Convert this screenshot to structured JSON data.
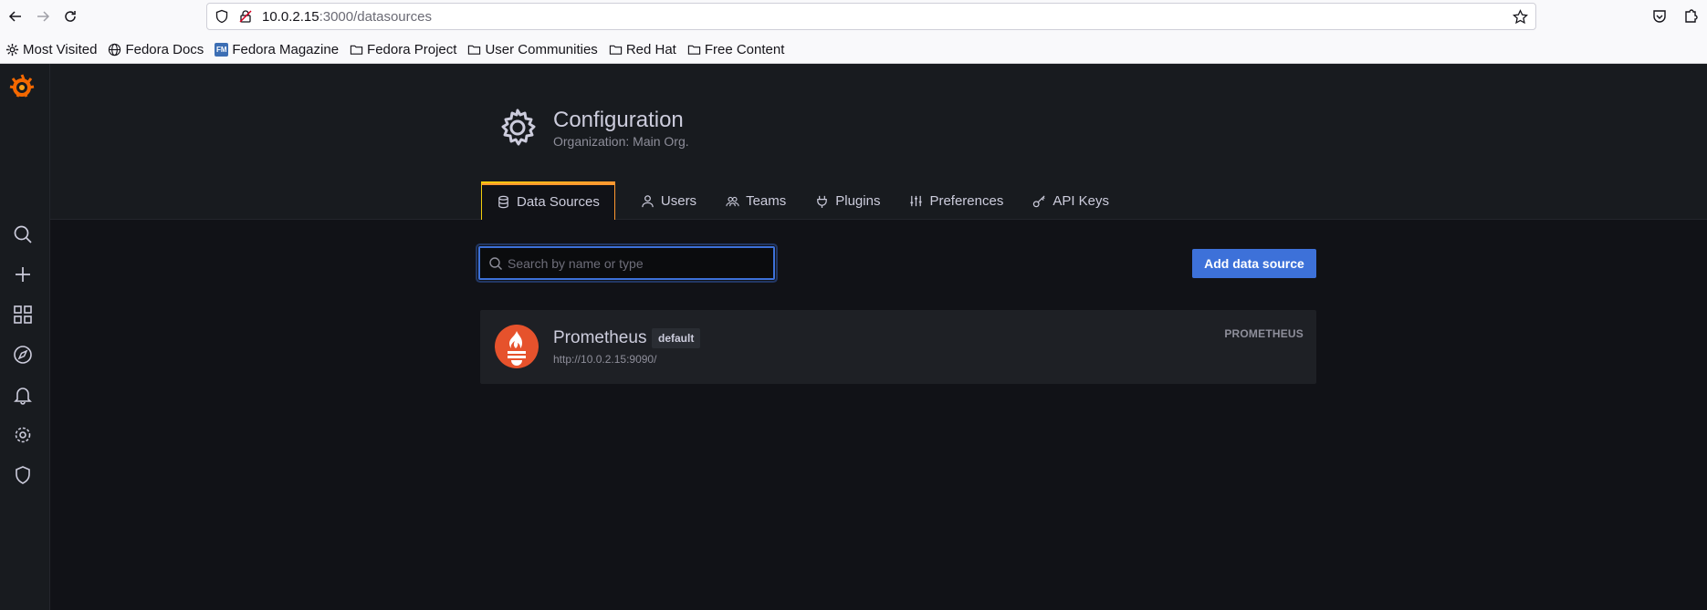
{
  "browser": {
    "url_host": "10.0.2.15",
    "url_path": ":3000/datasources",
    "bookmarks": [
      {
        "label": "Most Visited",
        "icon": "gear-icon"
      },
      {
        "label": "Fedora Docs",
        "icon": "globe-icon"
      },
      {
        "label": "Fedora Magazine",
        "icon": "fedora-magazine-icon"
      },
      {
        "label": "Fedora Project",
        "icon": "folder-icon"
      },
      {
        "label": "User Communities",
        "icon": "folder-icon"
      },
      {
        "label": "Red Hat",
        "icon": "folder-icon"
      },
      {
        "label": "Free Content",
        "icon": "folder-icon"
      }
    ]
  },
  "page": {
    "title": "Configuration",
    "subtitle": "Organization: Main Org."
  },
  "tabs": [
    {
      "label": "Data Sources",
      "icon": "database-icon",
      "active": true
    },
    {
      "label": "Users",
      "icon": "user-icon"
    },
    {
      "label": "Teams",
      "icon": "teams-icon"
    },
    {
      "label": "Plugins",
      "icon": "plug-icon"
    },
    {
      "label": "Preferences",
      "icon": "sliders-icon"
    },
    {
      "label": "API Keys",
      "icon": "key-icon"
    }
  ],
  "search": {
    "placeholder": "Search by name or type",
    "value": ""
  },
  "add_button": {
    "label": "Add data source"
  },
  "datasources": [
    {
      "name": "Prometheus",
      "badge": "default",
      "url": "http://10.0.2.15:9090/",
      "type": "PROMETHEUS"
    }
  ],
  "colors": {
    "accent": "#3d71d9",
    "brand": "#f46800",
    "prometheus": "#e6522c"
  }
}
